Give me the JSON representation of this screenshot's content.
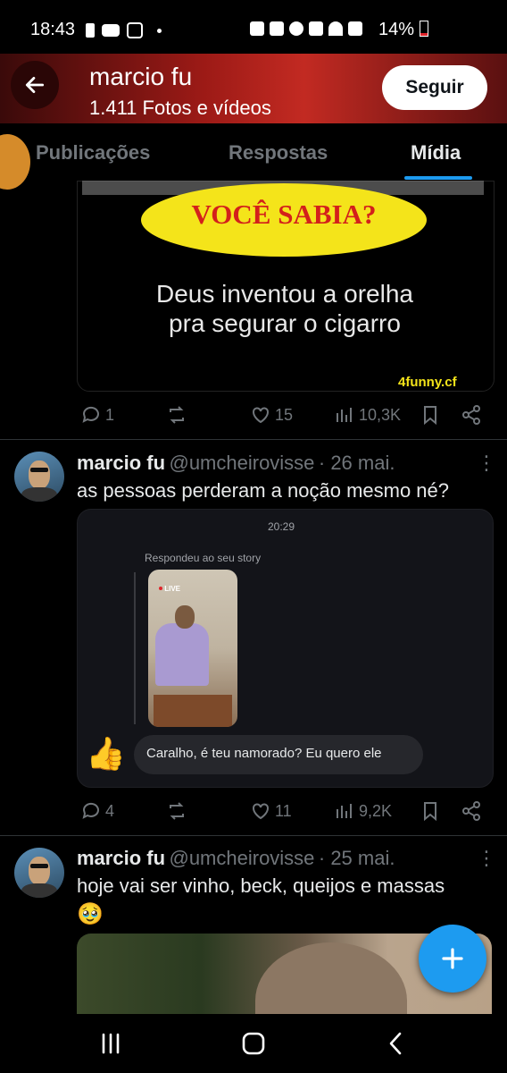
{
  "status_bar": {
    "time": "18:43",
    "battery": "14%"
  },
  "header": {
    "name": "marcio fu",
    "media_count": "1.411 Fotos e vídeos",
    "follow_label": "Seguir"
  },
  "tabs": [
    "Publicações",
    "Respostas",
    "Mídia"
  ],
  "active_tab": "Mídia",
  "post1": {
    "image_title": "VOCÊ SABIA?",
    "image_line1": "Deus inventou a orelha",
    "image_line2": "pra segurar o cigarro",
    "watermark": "4funny.cf",
    "replies": "1",
    "likes": "15",
    "views": "10,3K"
  },
  "post2": {
    "name": "marcio fu",
    "handle": "@umcheirovisse",
    "date": "· 26 mai.",
    "text": "as pessoas perderam a noção mesmo né?",
    "card_time": "20:29",
    "card_reply_label": "Respondeu ao seu story",
    "live_badge": "LIVE",
    "message": "Caralho, é teu namorado? Eu quero ele",
    "replies": "4",
    "likes": "11",
    "views": "9,2K"
  },
  "post3": {
    "name": "marcio fu",
    "handle": "@umcheirovisse",
    "date": "· 25 mai.",
    "text": "hoje vai ser vinho, beck, queijos e massas",
    "emoji": "🥹"
  },
  "colors": {
    "accent": "#1d9bf0",
    "header_red": "#c22a22",
    "banner_yellow": "#f4e41a"
  }
}
